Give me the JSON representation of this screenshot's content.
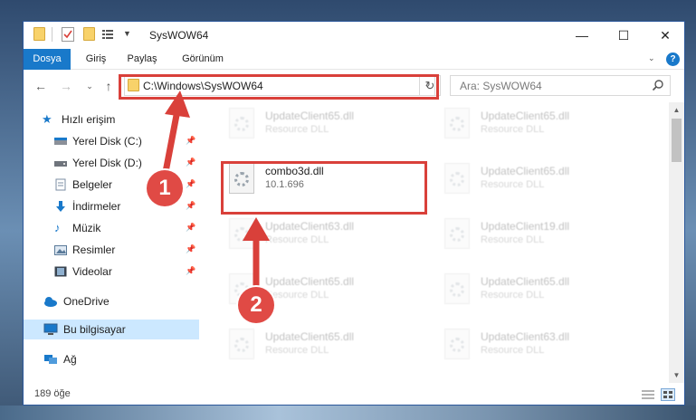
{
  "window": {
    "title": "SysWOW64"
  },
  "ribbon": {
    "tabs": [
      "Dosya",
      "Giriş",
      "Paylaş",
      "Görünüm"
    ]
  },
  "address": {
    "path": "C:\\Windows\\SysWOW64"
  },
  "search": {
    "placeholder": "Ara: SysWOW64"
  },
  "nav": {
    "quick_access": "Hızlı erişim",
    "items": [
      {
        "label": "Yerel Disk (C:)",
        "icon": "drive-icon"
      },
      {
        "label": "Yerel Disk (D:)",
        "icon": "drive-icon"
      },
      {
        "label": "Belgeler",
        "icon": "documents-icon"
      },
      {
        "label": "İndirmeler",
        "icon": "downloads-icon"
      },
      {
        "label": "Müzik",
        "icon": "music-icon"
      },
      {
        "label": "Resimler",
        "icon": "pictures-icon"
      },
      {
        "label": "Videolar",
        "icon": "videos-icon"
      }
    ],
    "onedrive": "OneDrive",
    "this_pc": "Bu bilgisayar",
    "network": "Ağ"
  },
  "files": {
    "highlighted": {
      "name": "combo3d.dll",
      "sub": "10.1.696"
    },
    "col1": [
      {
        "name": "UpdateClient65.dll",
        "sub": "Resource DLL"
      },
      {
        "name": "UpdateClient63.dll",
        "sub": "Resource DLL"
      },
      {
        "name": "UpdateClient65.dll",
        "sub": "Resource DLL"
      },
      {
        "name": "UpdateClient65.dll",
        "sub": "Resource DLL"
      }
    ],
    "col2": [
      {
        "name": "UpdateClient65.dll",
        "sub": "Resource DLL"
      },
      {
        "name": "UpdateClient65.dll",
        "sub": "Resource DLL"
      },
      {
        "name": "UpdateClient19.dll",
        "sub": "Resource DLL"
      },
      {
        "name": "UpdateClient65.dll",
        "sub": "Resource DLL"
      },
      {
        "name": "UpdateClient63.dll",
        "sub": "Resource DLL"
      }
    ]
  },
  "status": {
    "count": "189 öğe"
  },
  "annotations": {
    "step1": "1",
    "step2": "2"
  },
  "colors": {
    "accent": "#1979ca",
    "annotation": "#d9403a",
    "selected": "#cce8ff"
  }
}
